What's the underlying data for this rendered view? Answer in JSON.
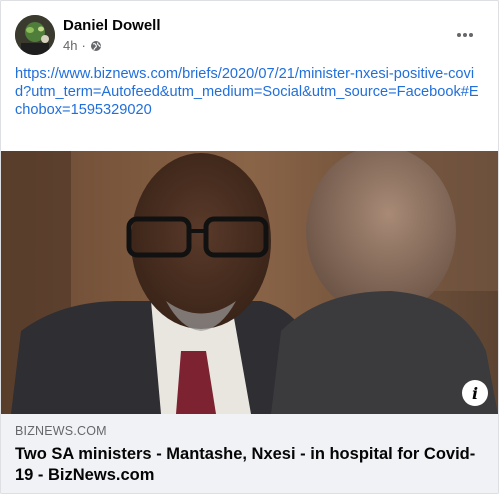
{
  "post": {
    "author": "Daniel Dowell",
    "time": "4h",
    "separator": "·",
    "privacy_icon": "globe-icon",
    "more_icon": "more-options-icon",
    "link_text": "https://www.biznews.com/briefs/2020/07/21/minister-nxesi-positive-covid?utm_term=Autofeed&utm_medium=Social&utm_source=Facebook#Echobox=1595329020"
  },
  "preview": {
    "domain": "BIZNEWS.COM",
    "headline": "Two SA ministers - Mantashe, Nxesi - in hospital for Covid-19 - BizNews.com",
    "info_icon": "i"
  },
  "colors": {
    "link": "#216fdb",
    "name": "#050505",
    "meta": "#65676b",
    "preview_bg": "#f0f2f5"
  }
}
